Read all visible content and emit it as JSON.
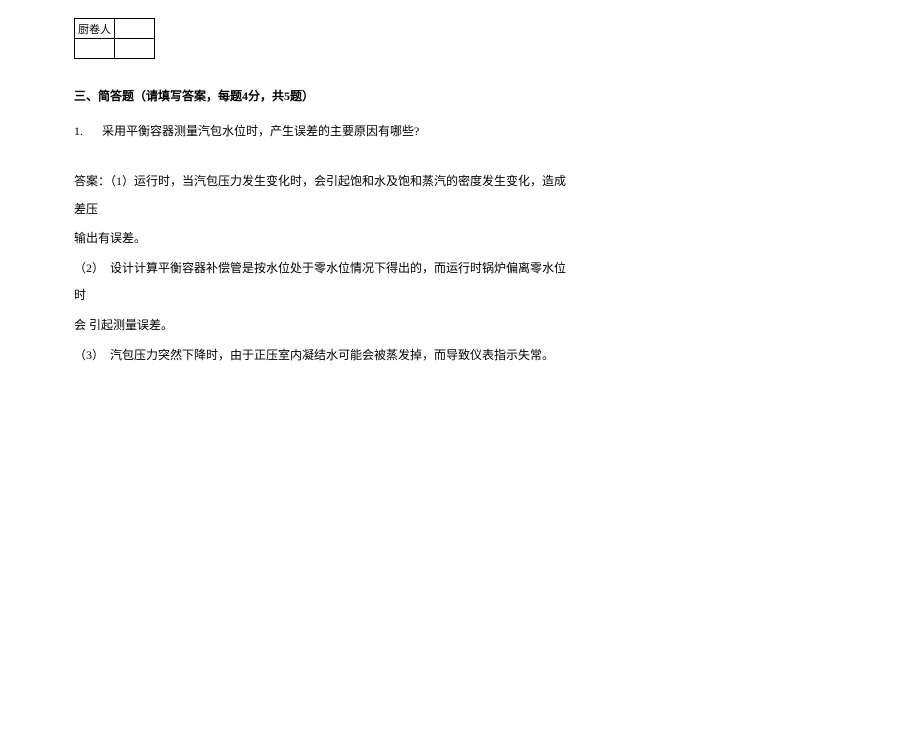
{
  "table": {
    "topLeft": "厨卷人",
    "topRight": "",
    "bottomLeft": "",
    "bottomRight": ""
  },
  "section": {
    "heading": "三、简答题（请填写答案，每题4分，共5题）"
  },
  "question1": {
    "number": "1.",
    "text": "采用平衡容器测量汽包水位时，产生误差的主要原因有哪些?"
  },
  "answer": {
    "line1": "答案：（1）运行时，当汽包压力发生变化时，会引起饱和水及饱和蒸汽的密度发生变化，造成差压",
    "line2": "输出有误差。",
    "line3": "（2）　设计计算平衡容器补偿管是按水位处于零水位情况下得出的，而运行时锅炉偏离零水位时",
    "line4": "会 引起测量误差。",
    "line5": "（3）　汽包压力突然下降时，由于正压室内凝结水可能会被蒸发掉，而导致仪表指示失常。"
  }
}
